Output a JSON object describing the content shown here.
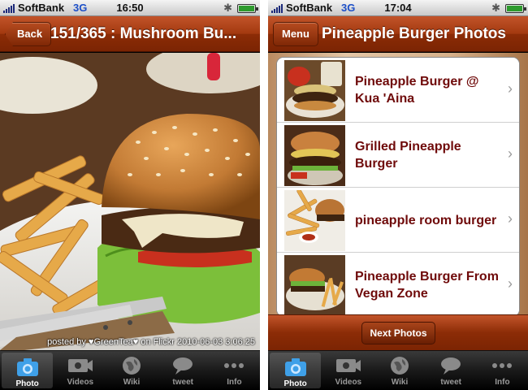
{
  "left_screen": {
    "status": {
      "carrier": "SoftBank",
      "network": "3G",
      "time": "16:50"
    },
    "nav": {
      "back_label": "Back",
      "title": "151/365 : Mushroom Bu..."
    },
    "photo": {
      "caption": "posted by ♥GreenTea♥ on Flickr 2010-06-03 3:06:25"
    },
    "tabs": [
      {
        "label": "Photo",
        "icon": "camera-icon",
        "active": true
      },
      {
        "label": "Videos",
        "icon": "film-icon"
      },
      {
        "label": "Wiki",
        "icon": "globe-icon"
      },
      {
        "label": "tweet",
        "icon": "speech-bubble-icon"
      },
      {
        "label": "Info",
        "icon": "more-dots-icon"
      }
    ]
  },
  "right_screen": {
    "status": {
      "carrier": "SoftBank",
      "network": "3G",
      "time": "17:04"
    },
    "nav": {
      "menu_label": "Menu",
      "title": "Pineapple Burger Photos"
    },
    "list": [
      {
        "title": "Pineapple Burger @ Kua 'Aina"
      },
      {
        "title": "Grilled Pineapple Burger"
      },
      {
        "title": "pineapple room burger"
      },
      {
        "title": "Pineapple Burger From Vegan Zone"
      }
    ],
    "next_label": "Next Photos",
    "tabs": [
      {
        "label": "Photo",
        "icon": "camera-icon",
        "active": true
      },
      {
        "label": "Videos",
        "icon": "film-icon"
      },
      {
        "label": "Wiki",
        "icon": "globe-icon"
      },
      {
        "label": "tweet",
        "icon": "speech-bubble-icon"
      },
      {
        "label": "Info",
        "icon": "more-dots-icon"
      }
    ]
  },
  "colors": {
    "nav_brown": "#a3390f",
    "list_title": "#6f0a0a",
    "tab_active": "#3fa0e8",
    "network_blue": "#1c4fc8"
  }
}
